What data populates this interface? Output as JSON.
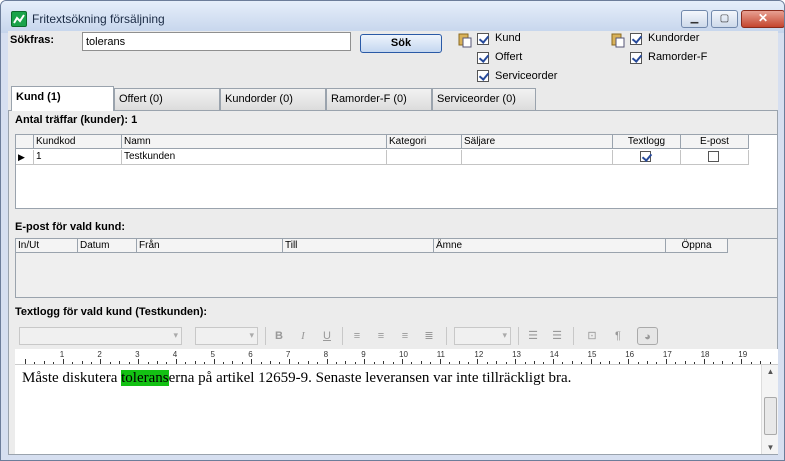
{
  "window": {
    "title": "Fritextsökning försäljning"
  },
  "search": {
    "label": "Sökfras:",
    "value": "tolerans",
    "button": "Sök"
  },
  "filters": {
    "group1": [
      {
        "label": "Kund",
        "checked": true
      },
      {
        "label": "Offert",
        "checked": true
      },
      {
        "label": "Serviceorder",
        "checked": true
      }
    ],
    "group2": [
      {
        "label": "Kundorder",
        "checked": true
      },
      {
        "label": "Ramorder-F",
        "checked": true
      }
    ]
  },
  "tabs": [
    "Kund (1)",
    "Offert (0)",
    "Kundorder (0)",
    "Ramorder-F (0)",
    "Serviceorder (0)"
  ],
  "results": {
    "heading": "Antal träffar (kunder): 1",
    "columns": [
      "Kundkod",
      "Namn",
      "Kategori",
      "Säljare",
      "Textlogg",
      "E-post"
    ],
    "rows": [
      {
        "kundkod": "1",
        "namn": "Testkunden",
        "kategori": "",
        "saljare": "",
        "textlogg": true,
        "epost": false
      }
    ]
  },
  "email": {
    "heading": "E-post för vald kund:",
    "columns": [
      "In/Ut",
      "Datum",
      "Från",
      "Till",
      "Ämne",
      "Öppna"
    ]
  },
  "textlog": {
    "heading": "Textlogg för vald kund (Testkunden):",
    "toolbar": [
      "B",
      "I",
      "U"
    ],
    "ruler": [
      "1",
      "2",
      "3",
      "4",
      "5",
      "6",
      "7",
      "8",
      "9",
      "10",
      "11",
      "12",
      "13",
      "14",
      "15",
      "16",
      "17",
      "18",
      "19"
    ],
    "text_before": "Måste diskutera ",
    "text_highlight": "tolerans",
    "text_after": "erna på artikel 12659-9. Senaste leveransen var inte tillräckligt bra."
  },
  "colors": {
    "highlight": "#13c113",
    "accent": "#2a5aa6"
  }
}
